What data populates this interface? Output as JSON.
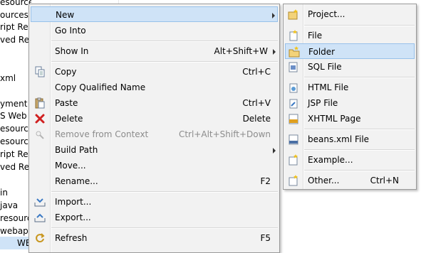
{
  "tree": {
    "items": [
      "esources",
      "ources",
      "ript Resc",
      "ved Resc",
      "",
      "",
      "xml",
      "",
      "yment D",
      "S Web S",
      "esources",
      "esources",
      "ript Resc",
      "ved Resc",
      "",
      "in",
      "java",
      "resourc",
      "webapp",
      "WEI"
    ]
  },
  "menu": {
    "new": {
      "label": "New"
    },
    "go_into": {
      "label": "Go Into"
    },
    "show_in": {
      "label": "Show In",
      "accel": "Alt+Shift+W"
    },
    "copy": {
      "label": "Copy",
      "accel": "Ctrl+C"
    },
    "copy_qualified": {
      "label": "Copy Qualified Name"
    },
    "paste": {
      "label": "Paste",
      "accel": "Ctrl+V"
    },
    "delete": {
      "label": "Delete",
      "accel": "Delete"
    },
    "remove_context": {
      "label": "Remove from Context",
      "accel": "Ctrl+Alt+Shift+Down"
    },
    "build_path": {
      "label": "Build Path"
    },
    "move": {
      "label": "Move..."
    },
    "rename": {
      "label": "Rename...",
      "accel": "F2"
    },
    "import": {
      "label": "Import..."
    },
    "export": {
      "label": "Export..."
    },
    "refresh": {
      "label": "Refresh",
      "accel": "F5"
    }
  },
  "submenu": {
    "project": {
      "label": "Project..."
    },
    "file": {
      "label": "File"
    },
    "folder": {
      "label": "Folder"
    },
    "sql_file": {
      "label": "SQL File"
    },
    "html_file": {
      "label": "HTML File"
    },
    "jsp_file": {
      "label": "JSP File"
    },
    "xhtml_page": {
      "label": "XHTML Page"
    },
    "beans_xml": {
      "label": "beans.xml File"
    },
    "example": {
      "label": "Example..."
    },
    "other": {
      "label": "Other...",
      "accel": "Ctrl+N"
    }
  },
  "colors": {
    "highlight": "#cfe3f7",
    "highlight_border": "#98c1ea",
    "menu_bg": "#f2f2f2",
    "disabled_text": "#8c8c8c"
  }
}
